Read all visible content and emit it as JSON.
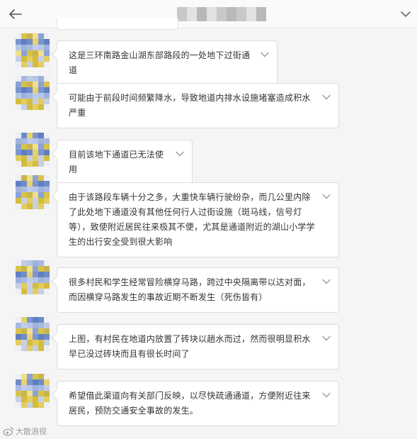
{
  "header": {
    "back_icon": "arrow-left-icon",
    "menu_icon": "chevron-down-icon"
  },
  "messages": [
    {
      "text": "这是三环南路金山湖东部路段的一处地下过街通道"
    },
    {
      "text": "可能由于前段时间频繁降水，导致地道内排水设施堵塞造成积水严重"
    },
    {
      "text": "目前该地下通道已无法使用"
    },
    {
      "text": "由于该路段车辆十分之多，大重快车辆行驶纷杂，而几公里内除了此处地下通道没有其他任何行人过街设施（斑马线，信号灯等），致使附近居民往来极其不便，尤其是通道附近的湖山小学学生的出行安全受到很大影响"
    },
    {
      "text": "很多村民和学生经常冒险横穿马路，跨过中央隔离带以达对面，而因横穿马路发生的事故近期不断发生（死伤皆有）"
    },
    {
      "text": "上图，有村民在地道内放置了砖块以趟水而过，然而很明显积水早已没过砖块而且有很长时间了"
    },
    {
      "text": "希望借此渠道向有关部门反映，以尽快疏通通道，方便附近往来居民，预防交通安全事故的发生。"
    }
  ],
  "watermark": {
    "icon": "weibo-icon",
    "text": "大散浪视"
  },
  "colors": {
    "background": "#f5f5f5",
    "bubble": "#ffffff",
    "border": "#dcdcdc"
  }
}
